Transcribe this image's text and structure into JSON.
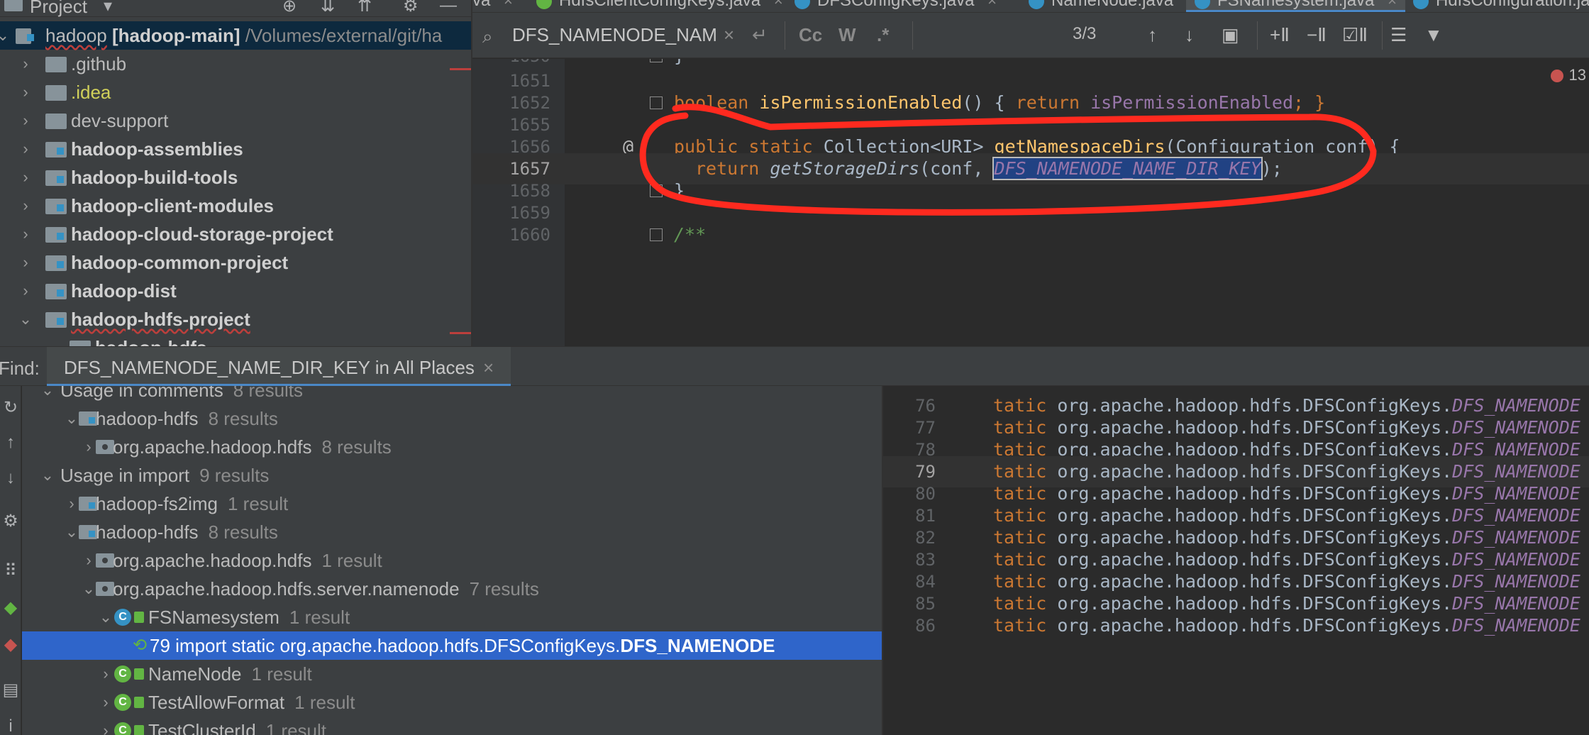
{
  "project_panel": {
    "title": "Project",
    "root": {
      "name": "hadoop",
      "module": "[hadoop-main]",
      "path": "/Volumes/external/git/ha"
    },
    "items": [
      {
        "label": ".github",
        "style": "plain"
      },
      {
        "label": ".idea",
        "style": "idea"
      },
      {
        "label": "dev-support",
        "style": "plain"
      },
      {
        "label": "hadoop-assemblies",
        "style": "module"
      },
      {
        "label": "hadoop-build-tools",
        "style": "module"
      },
      {
        "label": "hadoop-client-modules",
        "style": "module"
      },
      {
        "label": "hadoop-cloud-storage-project",
        "style": "module"
      },
      {
        "label": "hadoop-common-project",
        "style": "module"
      },
      {
        "label": "hadoop-dist",
        "style": "module"
      },
      {
        "label": "hadoop-hdfs-project",
        "style": "module"
      },
      {
        "label": "hadoop-hdfs",
        "style": "module"
      }
    ]
  },
  "tabs": [
    {
      "label": "va",
      "active": false
    },
    {
      "label": "HdfsClientConfigKeys.java",
      "active": false
    },
    {
      "label": "DFSConfigKeys.java",
      "active": false
    },
    {
      "label": "NameNode.java",
      "active": false
    },
    {
      "label": "FSNamesystem.java",
      "active": true
    },
    {
      "label": "HdfsConfiguration.java",
      "active": false
    }
  ],
  "search": {
    "query": "DFS_NAMENODE_NAME_DIR_KEY",
    "match_count": "3/3",
    "case_label": "Cc",
    "words_label": "W",
    "regex_label": ".*"
  },
  "editor": {
    "error_count": "13",
    "lines": [
      {
        "num": "1650",
        "text": "}"
      },
      {
        "num": "1651",
        "text": ""
      },
      {
        "num": "1652",
        "kw": "boolean",
        "fn": "isPermissionEnabled",
        "rest_open": "() {",
        "kw2": "return",
        "field": "isPermissionEnabled",
        "rest_close": "; }"
      },
      {
        "num": "1655",
        "text": ""
      },
      {
        "num": "1656",
        "kw": "public static",
        "type": "Collection<URI>",
        "fn": "getNamespaceDirs",
        "params": "(Configuration conf) {"
      },
      {
        "num": "1657",
        "kw": "return",
        "call": "getStorageDirs",
        "args_open": "(conf, ",
        "selected": "DFS_NAMENODE_NAME_DIR_KEY",
        "args_close": ");"
      },
      {
        "num": "1658",
        "text": "}"
      },
      {
        "num": "1659",
        "text": ""
      },
      {
        "num": "1660",
        "comment": "/**"
      }
    ],
    "at_symbol": "@"
  },
  "annotation_color": "#ff2a1f",
  "find": {
    "label": "Find:",
    "tab_title": "DFS_NAMENODE_NAME_DIR_KEY in All Places",
    "results": [
      {
        "label": "Usage in comments",
        "count": "8 results",
        "kind": "group"
      },
      {
        "label": "hadoop-hdfs",
        "count": "8 results",
        "kind": "module"
      },
      {
        "label": "org.apache.hadoop.hdfs",
        "count": "8 results",
        "kind": "package"
      },
      {
        "label": "Usage in import",
        "count": "9 results",
        "kind": "group"
      },
      {
        "label": "hadoop-fs2img",
        "count": "1 result",
        "kind": "module"
      },
      {
        "label": "hadoop-hdfs",
        "count": "8 results",
        "kind": "module"
      },
      {
        "label": "org.apache.hadoop.hdfs",
        "count": "1 result",
        "kind": "package"
      },
      {
        "label": "org.apache.hadoop.hdfs.server.namenode",
        "count": "7 results",
        "kind": "package"
      },
      {
        "label": "FSNamesystem",
        "count": "1 result",
        "kind": "class"
      },
      {
        "label_prefix": "79 import static org.apache.hadoop.hdfs.DFSConfigKeys.",
        "label_bold": "DFS_NAMENODE",
        "kind": "usage"
      },
      {
        "label": "NameNode",
        "count": "1 result",
        "kind": "class"
      },
      {
        "label": "TestAllowFormat",
        "count": "1 result",
        "kind": "class"
      },
      {
        "label": "TestClusterId",
        "count": "1 result",
        "kind": "class"
      }
    ],
    "preview": {
      "prefix": "tatic",
      "qualified": "org.apache.hadoop.hdfs.DFSConfigKeys.",
      "constant": "DFS_NAMENODE",
      "lines": [
        "76",
        "77",
        "78",
        "79",
        "80",
        "81",
        "82",
        "83",
        "84",
        "85",
        "86"
      ],
      "current": "79"
    }
  }
}
